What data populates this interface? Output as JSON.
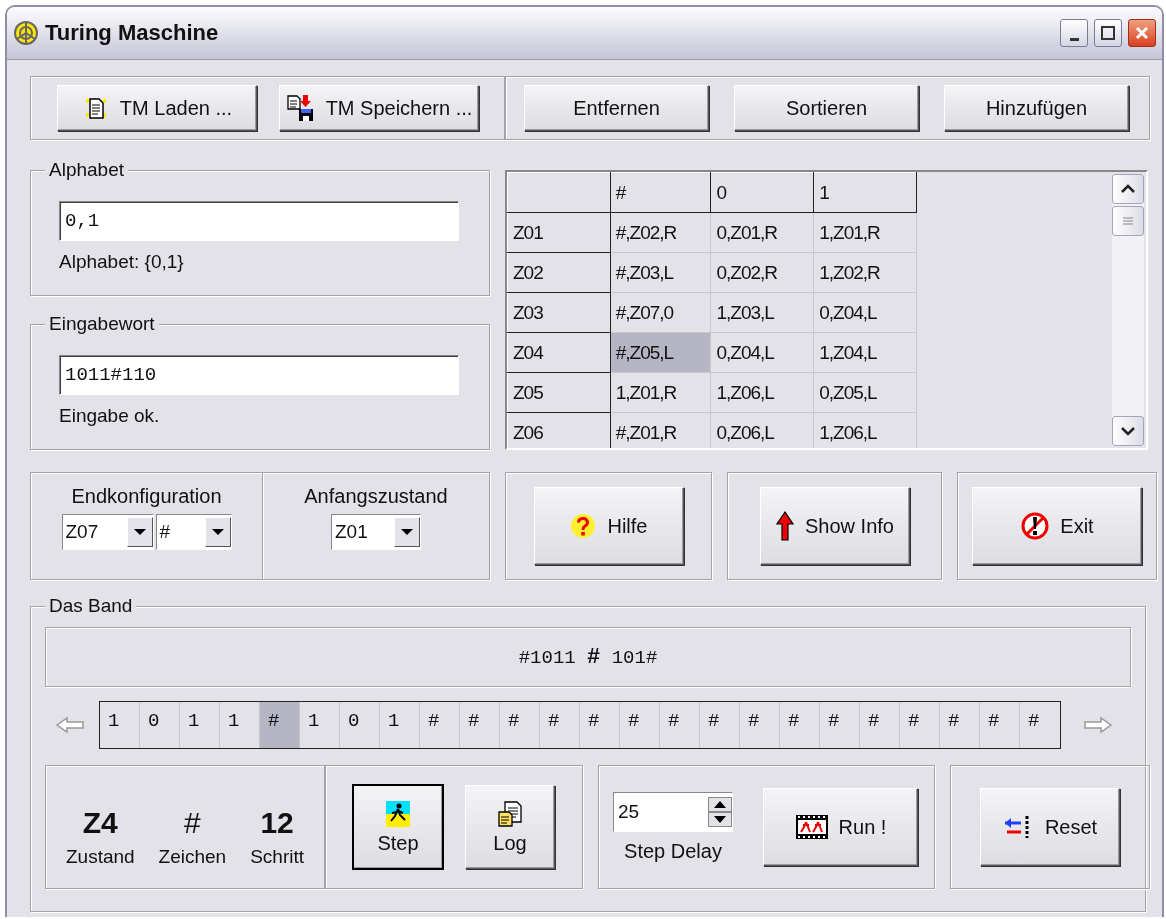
{
  "window": {
    "title": "Turing Maschine"
  },
  "file_buttons": [
    {
      "label": "TM Laden ...",
      "kind": "load"
    },
    {
      "label": "TM Speichern ...",
      "kind": "save"
    }
  ],
  "table_buttons": [
    {
      "label": "Entfernen"
    },
    {
      "label": "Sortieren"
    },
    {
      "label": "Hinzufügen"
    }
  ],
  "alphabet": {
    "title": "Alphabet",
    "value": "0,1",
    "message": "Alphabet: {0,1}"
  },
  "input_word": {
    "title": "Eingabewort",
    "value": "1011#110",
    "message": "Eingabe ok."
  },
  "table": {
    "columns": [
      "#",
      "0",
      "1"
    ],
    "rows": [
      {
        "state": "Z01",
        "cells": [
          {
            "text": "#,Z02,R",
            "selected": false
          },
          {
            "text": "0,Z01,R",
            "selected": false
          },
          {
            "text": "1,Z01,R",
            "selected": false
          }
        ]
      },
      {
        "state": "Z02",
        "cells": [
          {
            "text": "#,Z03,L",
            "selected": false
          },
          {
            "text": "0,Z02,R",
            "selected": false
          },
          {
            "text": "1,Z02,R",
            "selected": false
          }
        ]
      },
      {
        "state": "Z03",
        "cells": [
          {
            "text": "#,Z07,0",
            "selected": false
          },
          {
            "text": "1,Z03,L",
            "selected": false
          },
          {
            "text": "0,Z04,L",
            "selected": false
          }
        ]
      },
      {
        "state": "Z04",
        "cells": [
          {
            "text": "#,Z05,L",
            "selected": true
          },
          {
            "text": "0,Z04,L",
            "selected": false
          },
          {
            "text": "1,Z04,L",
            "selected": false
          }
        ]
      },
      {
        "state": "Z05",
        "cells": [
          {
            "text": "1,Z01,R",
            "selected": false
          },
          {
            "text": "1,Z06,L",
            "selected": false
          },
          {
            "text": "0,Z05,L",
            "selected": false
          }
        ]
      },
      {
        "state": "Z06",
        "cells": [
          {
            "text": "#,Z01,R",
            "selected": false
          },
          {
            "text": "0,Z06,L",
            "selected": false
          },
          {
            "text": "1,Z06,L",
            "selected": false
          }
        ]
      }
    ]
  },
  "end_configuration": {
    "title": "Endkonfiguration",
    "state": "Z07",
    "symbol": "#"
  },
  "start_state": {
    "title": "Anfangszustand",
    "value": "Z01"
  },
  "action_buttons": [
    {
      "label": "Hilfe",
      "kind": "help"
    },
    {
      "label": "Show Info",
      "kind": "info"
    },
    {
      "label": "Exit",
      "kind": "exit"
    }
  ],
  "band": {
    "title": "Das Band",
    "display": "#1011 **#** 101#",
    "cells": [
      {
        "symbol": "1",
        "selected": false
      },
      {
        "symbol": "0",
        "selected": false
      },
      {
        "symbol": "1",
        "selected": false
      },
      {
        "symbol": "1",
        "selected": false
      },
      {
        "symbol": "#",
        "selected": true
      },
      {
        "symbol": "1",
        "selected": false
      },
      {
        "symbol": "0",
        "selected": false
      },
      {
        "symbol": "1",
        "selected": false
      },
      {
        "symbol": "#",
        "selected": false
      },
      {
        "symbol": "#",
        "selected": false
      },
      {
        "symbol": "#",
        "selected": false
      },
      {
        "symbol": "#",
        "selected": false
      },
      {
        "symbol": "#",
        "selected": false
      },
      {
        "symbol": "#",
        "selected": false
      },
      {
        "symbol": "#",
        "selected": false
      },
      {
        "symbol": "#",
        "selected": false
      },
      {
        "symbol": "#",
        "selected": false
      },
      {
        "symbol": "#",
        "selected": false
      },
      {
        "symbol": "#",
        "selected": false
      },
      {
        "symbol": "#",
        "selected": false
      },
      {
        "symbol": "#",
        "selected": false
      },
      {
        "symbol": "#",
        "selected": false
      },
      {
        "symbol": "#",
        "selected": false
      },
      {
        "symbol": "#",
        "selected": false
      }
    ]
  },
  "status": [
    {
      "value": "Z4",
      "label": "Zustand",
      "kind": "state"
    },
    {
      "value": "#",
      "label": "Zeichen",
      "kind": "symbol"
    },
    {
      "value": "12",
      "label": "Schritt",
      "kind": "step"
    }
  ],
  "run_buttons": [
    {
      "label": "Step",
      "kind": "step",
      "focused": true
    },
    {
      "label": "Log",
      "kind": "log",
      "focused": false
    }
  ],
  "step_delay": {
    "value": "25",
    "label": "Step Delay"
  },
  "run_button": {
    "label": "Run !",
    "kind": "run"
  },
  "reset_button": {
    "label": "Reset",
    "kind": "reset"
  }
}
